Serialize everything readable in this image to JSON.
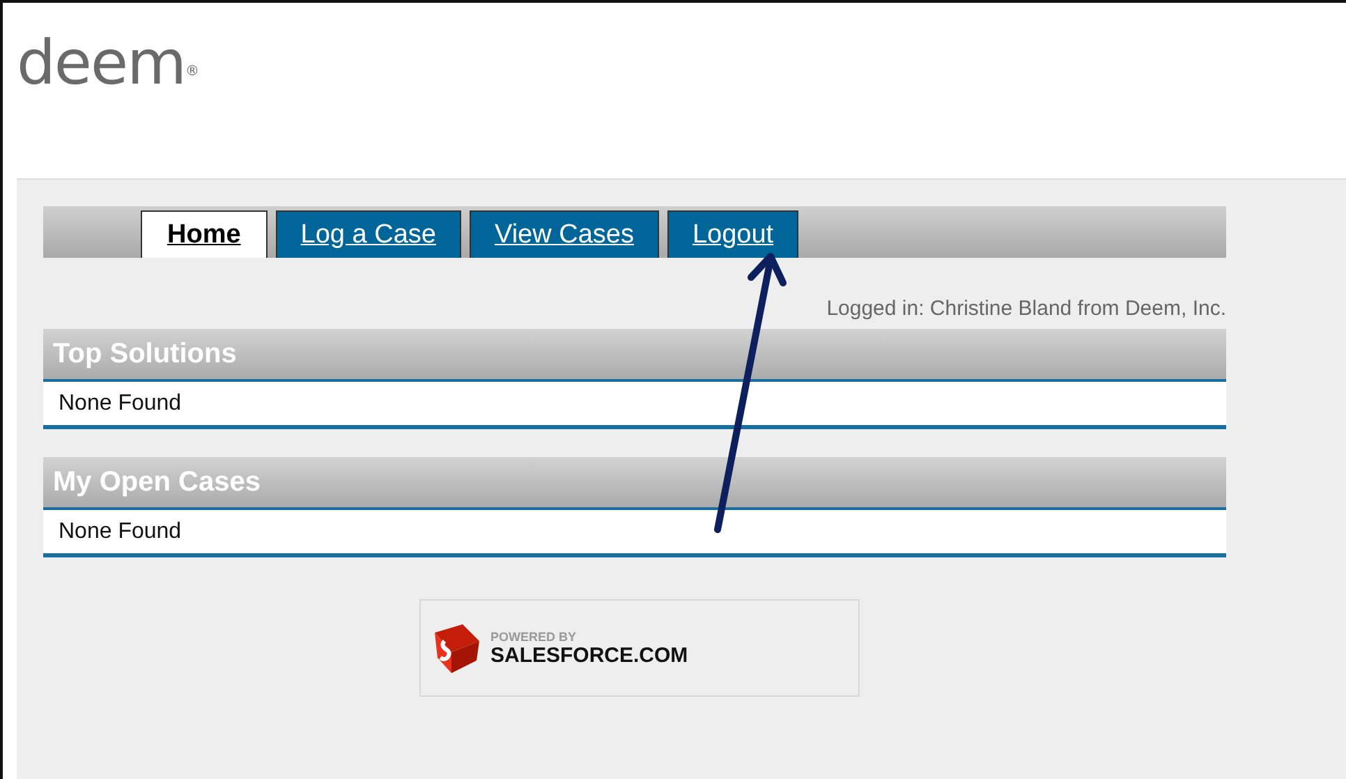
{
  "logo": {
    "text": "deem",
    "mark": "®"
  },
  "tabs": [
    {
      "label": "Home",
      "selected": true
    },
    {
      "label": "Log a Case",
      "selected": false
    },
    {
      "label": "View Cases",
      "selected": false
    },
    {
      "label": "Logout",
      "selected": false
    }
  ],
  "logged_in": "Logged in: Christine Bland from Deem, Inc.",
  "sections": [
    {
      "title": "Top Solutions",
      "body": "None Found"
    },
    {
      "title": "My Open Cases",
      "body": "None Found"
    }
  ],
  "footer_badge": {
    "line_1": "POWERED BY",
    "line_2": "SALESFORCE.COM"
  }
}
